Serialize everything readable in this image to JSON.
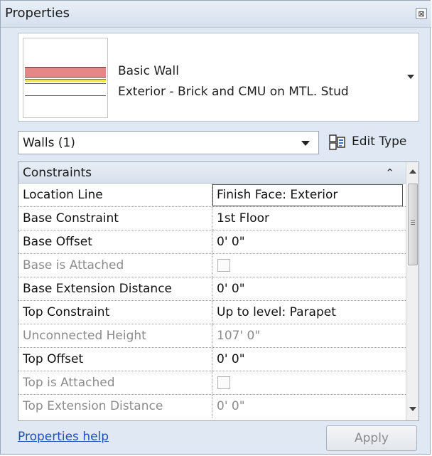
{
  "panel": {
    "title": "Properties",
    "close_glyph": "⊠"
  },
  "type_selector": {
    "family": "Basic Wall",
    "type_name": "Exterior - Brick and CMU on MTL. Stud",
    "preview_colors": {
      "brick": "#e58787",
      "insulation": "#f2e15a",
      "stud": "#ffffff"
    }
  },
  "filter": {
    "value": "Walls (1)"
  },
  "edit_type": {
    "label": "Edit Type",
    "icon": "edit-type-icon"
  },
  "properties": {
    "group": {
      "label": "Constraints",
      "collapse_glyph": "⌃"
    },
    "rows": [
      {
        "name": "Location Line",
        "value": "Finish Face: Exterior",
        "kind": "select",
        "enabled": true
      },
      {
        "name": "Base Constraint",
        "value": "1st Floor",
        "kind": "text",
        "enabled": true
      },
      {
        "name": "Base Offset",
        "value": "0' 0\"",
        "kind": "text",
        "enabled": true
      },
      {
        "name": "Base is Attached",
        "value": "",
        "kind": "checkbox",
        "checked": false,
        "enabled": false
      },
      {
        "name": "Base Extension Distance",
        "value": "0' 0\"",
        "kind": "text",
        "enabled": true
      },
      {
        "name": "Top Constraint",
        "value": "Up to level: Parapet",
        "kind": "text",
        "enabled": true
      },
      {
        "name": "Unconnected Height",
        "value": "107' 0\"",
        "kind": "text",
        "enabled": false
      },
      {
        "name": "Top Offset",
        "value": "0' 0\"",
        "kind": "text",
        "enabled": true
      },
      {
        "name": "Top is Attached",
        "value": "",
        "kind": "checkbox",
        "checked": false,
        "enabled": false
      },
      {
        "name": "Top Extension Distance",
        "value": "0' 0\"",
        "kind": "text",
        "enabled": false
      }
    ]
  },
  "footer": {
    "help_link": "Properties help",
    "apply_label": "Apply"
  }
}
